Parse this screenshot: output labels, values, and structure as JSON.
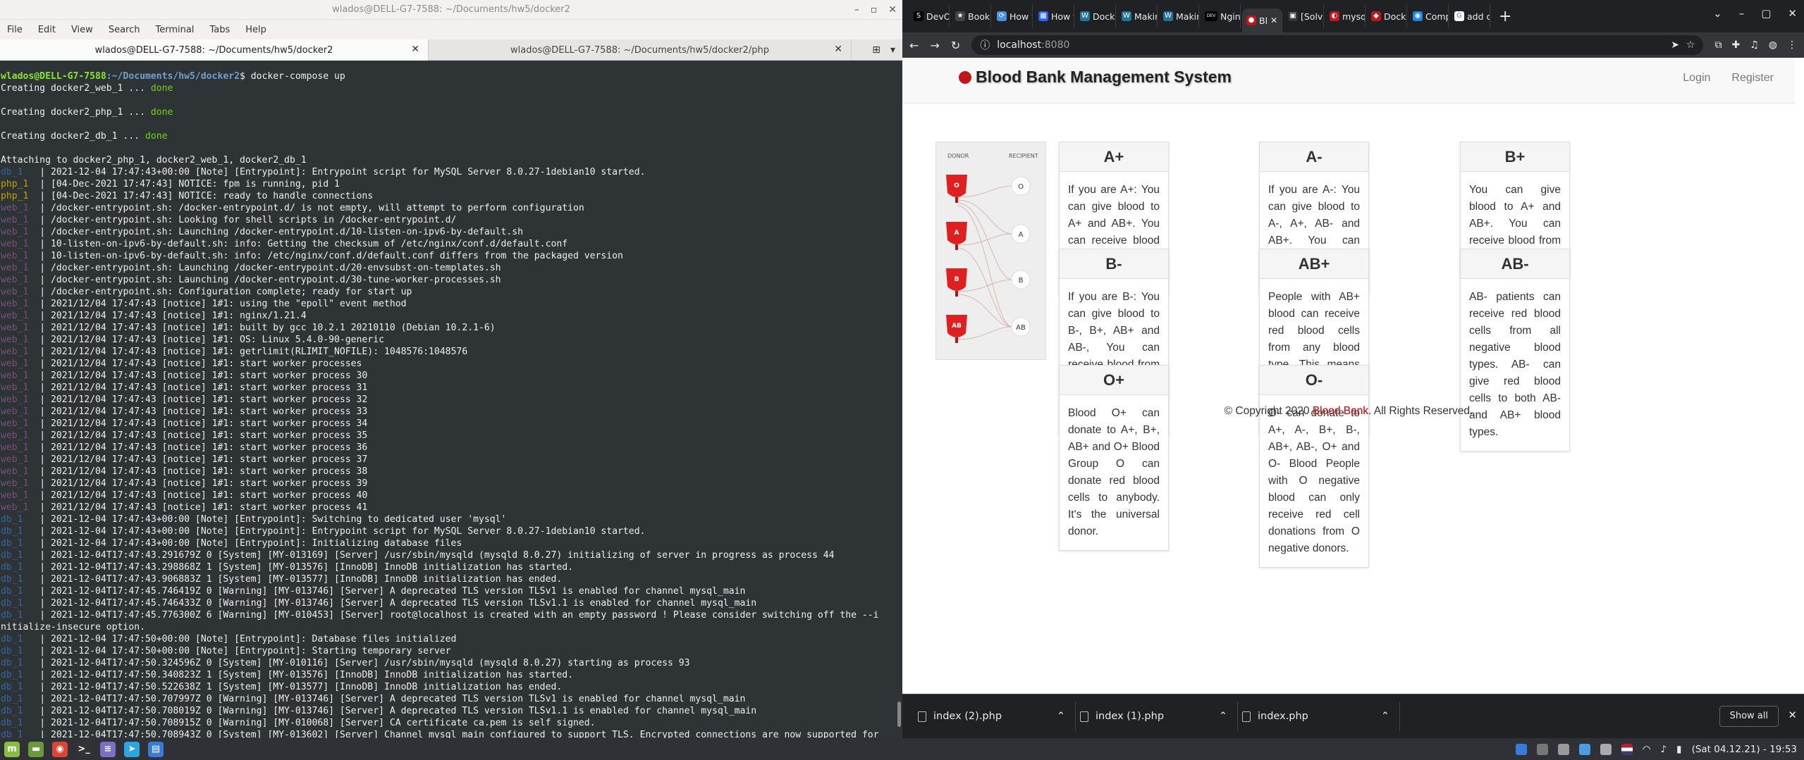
{
  "terminal": {
    "window_title": "wlados@DELL-G7-7588: ~/Documents/hw5/docker2",
    "menu": [
      "File",
      "Edit",
      "View",
      "Search",
      "Terminal",
      "Tabs",
      "Help"
    ],
    "tabs": [
      {
        "label": "wlados@DELL-G7-7588: ~/Documents/hw5/docker2",
        "active": true
      },
      {
        "label": "wlados@DELL-G7-7588: ~/Documents/hw5/docker2/php",
        "active": false
      }
    ],
    "prompt_user": "wlados@DELL-G7-7588",
    "prompt_path": ":~/Documents/hw5/docker2",
    "prompt_cmd": "$ docker-compose up",
    "creating": [
      {
        "text": "Creating docker2_web_1 ... ",
        "status": "done"
      },
      {
        "text": "Creating docker2_php_1 ... ",
        "status": "done"
      },
      {
        "text": "Creating docker2_db_1 ... ",
        "status": "done"
      }
    ],
    "attaching": "Attaching to docker2_php_1, docker2_web_1, docker2_db_1",
    "log": [
      {
        "svc": "db_1 ",
        "msg": "2021-12-04 17:47:43+00:00 [Note] [Entrypoint]: Entrypoint script for MySQL Server 8.0.27-1debian10 started."
      },
      {
        "svc": "php_1",
        "msg": "[04-Dec-2021 17:47:43] NOTICE: fpm is running, pid 1"
      },
      {
        "svc": "php_1",
        "msg": "[04-Dec-2021 17:47:43] NOTICE: ready to handle connections"
      },
      {
        "svc": "web_1",
        "msg": "/docker-entrypoint.sh: /docker-entrypoint.d/ is not empty, will attempt to perform configuration"
      },
      {
        "svc": "web_1",
        "msg": "/docker-entrypoint.sh: Looking for shell scripts in /docker-entrypoint.d/"
      },
      {
        "svc": "web_1",
        "msg": "/docker-entrypoint.sh: Launching /docker-entrypoint.d/10-listen-on-ipv6-by-default.sh"
      },
      {
        "svc": "web_1",
        "msg": "10-listen-on-ipv6-by-default.sh: info: Getting the checksum of /etc/nginx/conf.d/default.conf"
      },
      {
        "svc": "web_1",
        "msg": "10-listen-on-ipv6-by-default.sh: info: /etc/nginx/conf.d/default.conf differs from the packaged version"
      },
      {
        "svc": "web_1",
        "msg": "/docker-entrypoint.sh: Launching /docker-entrypoint.d/20-envsubst-on-templates.sh"
      },
      {
        "svc": "web_1",
        "msg": "/docker-entrypoint.sh: Launching /docker-entrypoint.d/30-tune-worker-processes.sh"
      },
      {
        "svc": "web_1",
        "msg": "/docker-entrypoint.sh: Configuration complete; ready for start up"
      },
      {
        "svc": "web_1",
        "msg": "2021/12/04 17:47:43 [notice] 1#1: using the \"epoll\" event method"
      },
      {
        "svc": "web_1",
        "msg": "2021/12/04 17:47:43 [notice] 1#1: nginx/1.21.4"
      },
      {
        "svc": "web_1",
        "msg": "2021/12/04 17:47:43 [notice] 1#1: built by gcc 10.2.1 20210110 (Debian 10.2.1-6)"
      },
      {
        "svc": "web_1",
        "msg": "2021/12/04 17:47:43 [notice] 1#1: OS: Linux 5.4.0-90-generic"
      },
      {
        "svc": "web_1",
        "msg": "2021/12/04 17:47:43 [notice] 1#1: getrlimit(RLIMIT_NOFILE): 1048576:1048576"
      },
      {
        "svc": "web_1",
        "msg": "2021/12/04 17:47:43 [notice] 1#1: start worker processes"
      },
      {
        "svc": "web_1",
        "msg": "2021/12/04 17:47:43 [notice] 1#1: start worker process 30"
      },
      {
        "svc": "web_1",
        "msg": "2021/12/04 17:47:43 [notice] 1#1: start worker process 31"
      },
      {
        "svc": "web_1",
        "msg": "2021/12/04 17:47:43 [notice] 1#1: start worker process 32"
      },
      {
        "svc": "web_1",
        "msg": "2021/12/04 17:47:43 [notice] 1#1: start worker process 33"
      },
      {
        "svc": "web_1",
        "msg": "2021/12/04 17:47:43 [notice] 1#1: start worker process 34"
      },
      {
        "svc": "web_1",
        "msg": "2021/12/04 17:47:43 [notice] 1#1: start worker process 35"
      },
      {
        "svc": "web_1",
        "msg": "2021/12/04 17:47:43 [notice] 1#1: start worker process 36"
      },
      {
        "svc": "web_1",
        "msg": "2021/12/04 17:47:43 [notice] 1#1: start worker process 37"
      },
      {
        "svc": "web_1",
        "msg": "2021/12/04 17:47:43 [notice] 1#1: start worker process 38"
      },
      {
        "svc": "web_1",
        "msg": "2021/12/04 17:47:43 [notice] 1#1: start worker process 39"
      },
      {
        "svc": "web_1",
        "msg": "2021/12/04 17:47:43 [notice] 1#1: start worker process 40"
      },
      {
        "svc": "web_1",
        "msg": "2021/12/04 17:47:43 [notice] 1#1: start worker process 41"
      },
      {
        "svc": "db_1 ",
        "msg": "2021-12-04 17:47:43+00:00 [Note] [Entrypoint]: Switching to dedicated user 'mysql'"
      },
      {
        "svc": "db_1 ",
        "msg": "2021-12-04 17:47:43+00:00 [Note] [Entrypoint]: Entrypoint script for MySQL Server 8.0.27-1debian10 started."
      },
      {
        "svc": "db_1 ",
        "msg": "2021-12-04 17:47:43+00:00 [Note] [Entrypoint]: Initializing database files"
      },
      {
        "svc": "db_1 ",
        "msg": "2021-12-04T17:47:43.291679Z 0 [System] [MY-013169] [Server] /usr/sbin/mysqld (mysqld 8.0.27) initializing of server in progress as process 44"
      },
      {
        "svc": "db_1 ",
        "msg": "2021-12-04T17:47:43.298868Z 1 [System] [MY-013576] [InnoDB] InnoDB initialization has started."
      },
      {
        "svc": "db_1 ",
        "msg": "2021-12-04T17:47:43.906883Z 1 [System] [MY-013577] [InnoDB] InnoDB initialization has ended."
      },
      {
        "svc": "db_1 ",
        "msg": "2021-12-04T17:47:45.746419Z 0 [Warning] [MY-013746] [Server] A deprecated TLS version TLSv1 is enabled for channel mysql_main"
      },
      {
        "svc": "db_1 ",
        "msg": "2021-12-04T17:47:45.746433Z 0 [Warning] [MY-013746] [Server] A deprecated TLS version TLSv1.1 is enabled for channel mysql_main"
      },
      {
        "svc": "db_1 ",
        "msg": "2021-12-04T17:47:45.776300Z 6 [Warning] [MY-010453] [Server] root@localhost is created with an empty password ! Please consider switching off the --i"
      },
      {
        "svc": "",
        "msg": "nitialize-insecure option."
      },
      {
        "svc": "db_1 ",
        "msg": "2021-12-04 17:47:50+00:00 [Note] [Entrypoint]: Database files initialized"
      },
      {
        "svc": "db_1 ",
        "msg": "2021-12-04 17:47:50+00:00 [Note] [Entrypoint]: Starting temporary server"
      },
      {
        "svc": "db_1 ",
        "msg": "2021-12-04T17:47:50.324596Z 0 [System] [MY-010116] [Server] /usr/sbin/mysqld (mysqld 8.0.27) starting as process 93"
      },
      {
        "svc": "db_1 ",
        "msg": "2021-12-04T17:47:50.340823Z 1 [System] [MY-013576] [InnoDB] InnoDB initialization has started."
      },
      {
        "svc": "db_1 ",
        "msg": "2021-12-04T17:47:50.522638Z 1 [System] [MY-013577] [InnoDB] InnoDB initialization has ended."
      },
      {
        "svc": "db_1 ",
        "msg": "2021-12-04T17:47:50.707997Z 0 [Warning] [MY-013746] [Server] A deprecated TLS version TLSv1 is enabled for channel mysql_main"
      },
      {
        "svc": "db_1 ",
        "msg": "2021-12-04T17:47:50.708019Z 0 [Warning] [MY-013746] [Server] A deprecated TLS version TLSv1.1 is enabled for channel mysql_main"
      },
      {
        "svc": "db_1 ",
        "msg": "2021-12-04T17:47:50.708915Z 0 [Warning] [MY-010068] [Server] CA certificate ca.pem is self signed."
      },
      {
        "svc": "db_1 ",
        "msg": "2021-12-04T17:47:50.708943Z 0 [System] [MY-013602] [Server] Channel mysql_main configured to support TLS. Encrypted connections are now supported for"
      }
    ]
  },
  "browser": {
    "tabs": [
      {
        "icon": "S",
        "color": "#000000",
        "label": "DevOp"
      },
      {
        "icon": "★",
        "color": "#444444",
        "label": "Bookm"
      },
      {
        "icon": "⟳",
        "color": "#4a90e2",
        "label": "How t"
      },
      {
        "icon": "▦",
        "color": "#2962ff",
        "label": "How t"
      },
      {
        "icon": "W",
        "color": "#21759b",
        "label": "Dock"
      },
      {
        "icon": "W",
        "color": "#21759b",
        "label": "Makin"
      },
      {
        "icon": "W",
        "color": "#21759b",
        "label": "Makin"
      },
      {
        "icon": "DEV",
        "color": "#000000",
        "label": "Ngin"
      },
      {
        "icon": "●",
        "color": "#c0171b",
        "label": "Bl",
        "active": true
      },
      {
        "icon": "▣",
        "color": "#333333",
        "label": "[Solv"
      },
      {
        "icon": "◐",
        "color": "#c0171b",
        "label": "mysql"
      },
      {
        "icon": "◆",
        "color": "#c0171b",
        "label": "Dock"
      },
      {
        "icon": "◉",
        "color": "#1e88e5",
        "label": "Comp"
      },
      {
        "icon": "G",
        "color": "#ffffff",
        "label": "add d"
      }
    ],
    "url_host": "localhost",
    "url_port": ":8080",
    "page": {
      "brand": "Blood Bank Management System",
      "nav": [
        "Login",
        "Register"
      ],
      "diagram": {
        "donor_label": "DONOR",
        "recipient_label": "RECIPIENT",
        "donors": [
          "O",
          "A",
          "B",
          "AB"
        ],
        "recipients": [
          "O",
          "A",
          "B",
          "AB"
        ]
      },
      "cards": [
        {
          "title": "A+",
          "text": "If you are A+: You can give blood to A+ and AB+. You can receive blood from A+, A-, O+ and O-"
        },
        {
          "title": "A-",
          "text": "If you are A-: You can give blood to A-, A+, AB- and AB+. You can receive blood from A- and O-."
        },
        {
          "title": "B+",
          "text": "You can give blood to A+ and AB+. You can receive blood from A+, A-, O+ and O-."
        },
        {
          "title": "B-",
          "text": "If you are B-: You can give blood to B-, B+, AB+ and AB-, You can receive blood from B- and O-.You can give blood to B+ and AB+."
        },
        {
          "title": "AB+",
          "text": "People with AB+ blood can receive red blood cells from any blood type. This means that demand for AB+ can donate with AB only."
        },
        {
          "title": "AB-",
          "text": "AB- patients can receive red blood cells from all negative blood types. AB- can give red blood cells to both AB- and AB+ blood types."
        },
        {
          "title": "O+",
          "text": "Blood O+ can donate to A+, B+, AB+ and O+ Blood Group O can donate red blood cells to anybody. It's the universal donor."
        },
        {
          "title": "O-",
          "text": "O- can donate to A+, A-, B+, B-, AB+, AB-, O+ and O- Blood People with O negative blood can only receive red cell donations from O negative donors."
        }
      ],
      "footer_pre": "© Copyright 2020 ",
      "footer_brand": "Blood Bank",
      "footer_post": ". All Rights Reserved."
    },
    "downloads": [
      "index (2).php",
      "index (1).php",
      "index.php"
    ],
    "show_all": "Show all"
  },
  "taskbar": {
    "clock": "(Sat 04.12.21) - 19:53",
    "apps": [
      {
        "name": "mint-menu-icon",
        "color": "#86be43",
        "glyph": "m"
      },
      {
        "name": "files-icon",
        "color": "#6a9a3a",
        "glyph": "▬"
      },
      {
        "name": "chrome-icon",
        "color": "#db4437",
        "glyph": "◉"
      },
      {
        "name": "terminal-icon",
        "color": "#333333",
        "glyph": ">_"
      },
      {
        "name": "text-editor-icon",
        "color": "#7b6fc2",
        "glyph": "≡"
      },
      {
        "name": "telegram-icon",
        "color": "#2ca5e0",
        "glyph": "➤"
      },
      {
        "name": "calculator-icon",
        "color": "#3a7bd5",
        "glyph": "▤"
      }
    ]
  }
}
